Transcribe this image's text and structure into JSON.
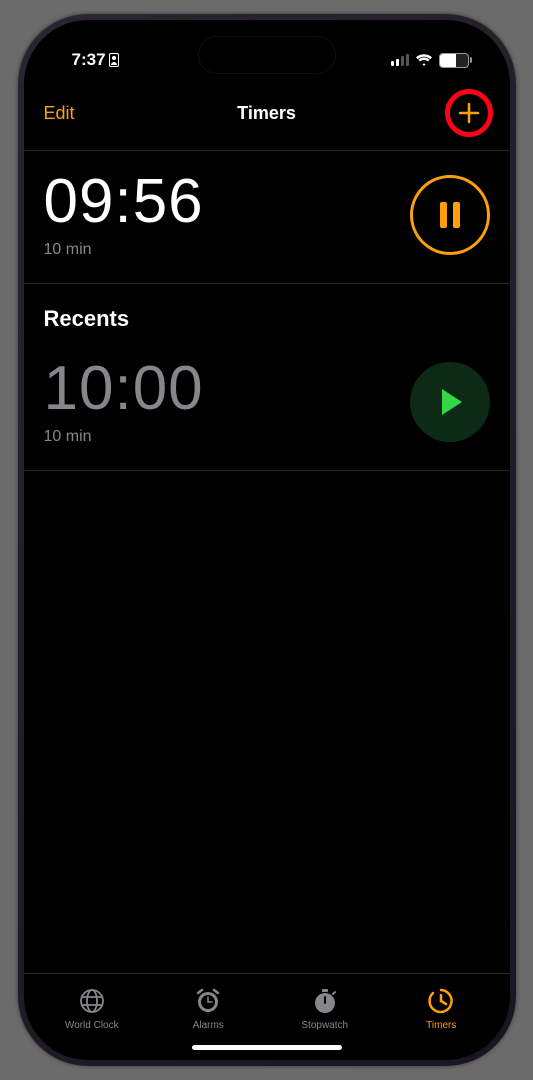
{
  "status_bar": {
    "time": "7:37",
    "battery_percent": "58"
  },
  "nav": {
    "edit_label": "Edit",
    "title": "Timers"
  },
  "active_timer": {
    "time": "09:56",
    "label": "10 min"
  },
  "sections": {
    "recents": "Recents"
  },
  "recent_timer": {
    "time": "10:00",
    "label": "10 min"
  },
  "tabs": {
    "world_clock": "World Clock",
    "alarms": "Alarms",
    "stopwatch": "Stopwatch",
    "timers": "Timers"
  },
  "colors": {
    "accent": "#ff9f0a",
    "success": "#32d74b",
    "annotation": "#ff0018"
  }
}
